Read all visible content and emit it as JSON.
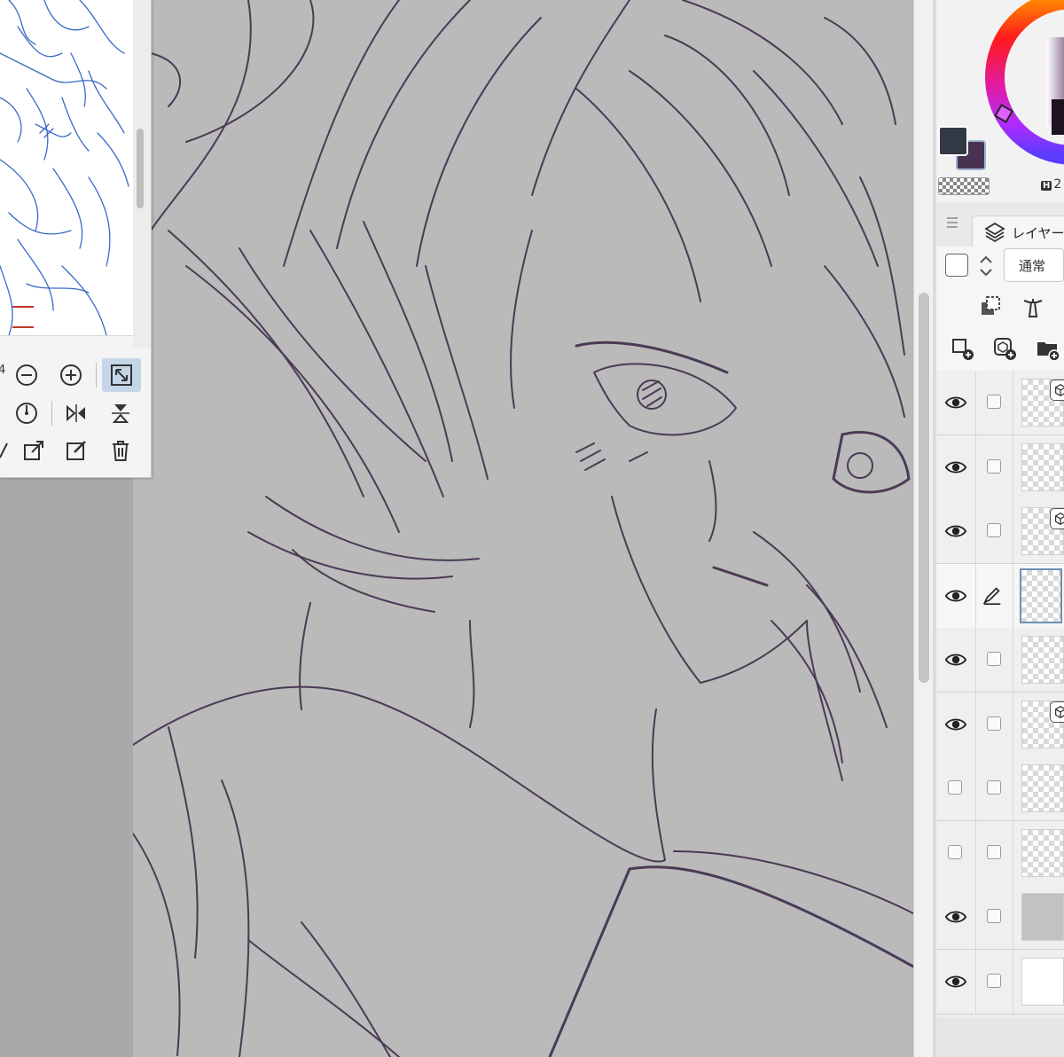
{
  "navigator": {
    "zoom_fragment": "4",
    "buttons_row1": [
      "zoom-out",
      "zoom-in",
      "fit-window"
    ],
    "buttons_row2": [
      "rotate-reset",
      "flip-horizontal",
      "flip-vertical"
    ],
    "buttons_row3": [
      "register",
      "export",
      "edit",
      "delete"
    ]
  },
  "colors": {
    "main": "#333845",
    "sub": "#4a3350",
    "lineart": "#4b3a55",
    "sketch_blue": "#3a6ac8",
    "canvas_bg": "#bababa"
  },
  "color_panel": {
    "hsv_label": "H",
    "hsv_value": "2"
  },
  "layer_panel": {
    "tab_label": "レイヤー",
    "blend_mode": "通常",
    "layers": [
      {
        "visible": true,
        "editing": false,
        "thumb": "transparent",
        "badge": true
      },
      {
        "visible": true,
        "editing": false,
        "thumb": "transparent",
        "badge": false
      },
      {
        "visible": true,
        "editing": false,
        "thumb": "transparent",
        "badge": true
      },
      {
        "visible": true,
        "editing": true,
        "thumb": "transparent",
        "badge": false,
        "selected": true
      },
      {
        "visible": true,
        "editing": false,
        "thumb": "transparent",
        "badge": false
      },
      {
        "visible": true,
        "editing": false,
        "thumb": "transparent",
        "badge": true
      },
      {
        "visible": false,
        "editing": false,
        "thumb": "transparent",
        "badge": false
      },
      {
        "visible": false,
        "editing": false,
        "thumb": "transparent",
        "badge": false
      },
      {
        "visible": true,
        "editing": false,
        "thumb": "gray",
        "badge": false
      },
      {
        "visible": true,
        "editing": false,
        "thumb": "white",
        "badge": false
      }
    ]
  }
}
